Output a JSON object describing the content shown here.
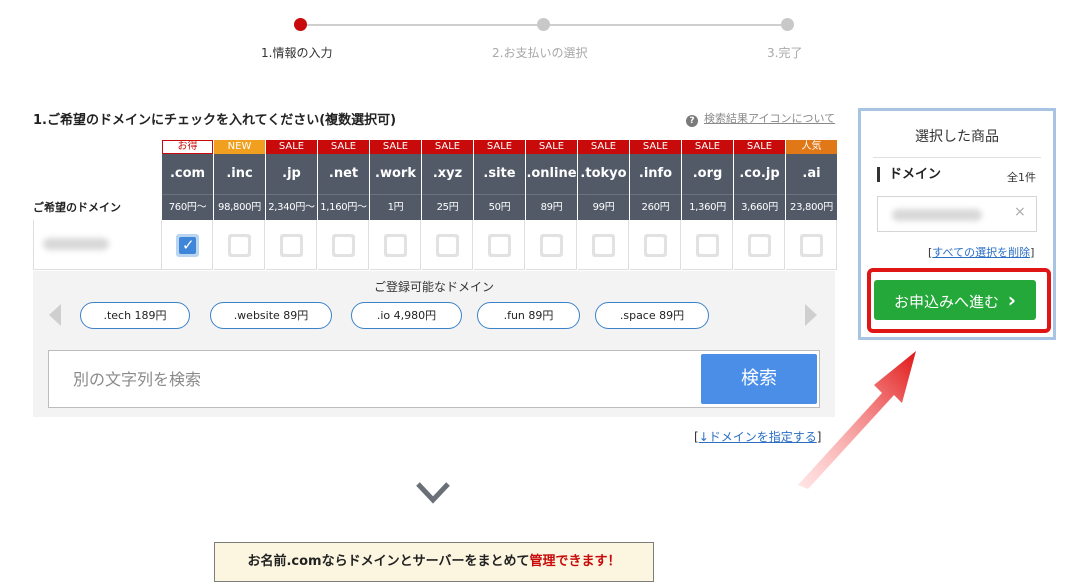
{
  "steps": [
    {
      "label": "1.情報の入力",
      "active": true
    },
    {
      "label": "2.お支払いの選択",
      "active": false
    },
    {
      "label": "3.完了",
      "active": false
    }
  ],
  "section_title": "1.ご希望のドメインにチェックを入れてください(複数選択可)",
  "help_link": "検索結果アイコンについて",
  "domain_row_label": "ご希望のドメイン",
  "tlds": [
    {
      "tag": "お得",
      "tag_type": "deal",
      "tld": ".com",
      "price": "760円〜",
      "checked": true
    },
    {
      "tag": "NEW",
      "tag_type": "new",
      "tld": ".inc",
      "price": "98,800円",
      "checked": false
    },
    {
      "tag": "SALE",
      "tag_type": "sale",
      "tld": ".jp",
      "price": "2,340円〜",
      "checked": false
    },
    {
      "tag": "SALE",
      "tag_type": "sale",
      "tld": ".net",
      "price": "1,160円〜",
      "checked": false
    },
    {
      "tag": "SALE",
      "tag_type": "sale",
      "tld": ".work",
      "price": "1円",
      "checked": false
    },
    {
      "tag": "SALE",
      "tag_type": "sale",
      "tld": ".xyz",
      "price": "25円",
      "checked": false
    },
    {
      "tag": "SALE",
      "tag_type": "sale",
      "tld": ".site",
      "price": "50円",
      "checked": false
    },
    {
      "tag": "SALE",
      "tag_type": "sale",
      "tld": ".online",
      "price": "89円",
      "checked": false
    },
    {
      "tag": "SALE",
      "tag_type": "sale",
      "tld": ".tokyo",
      "price": "99円",
      "checked": false
    },
    {
      "tag": "SALE",
      "tag_type": "sale",
      "tld": ".info",
      "price": "260円",
      "checked": false
    },
    {
      "tag": "SALE",
      "tag_type": "sale",
      "tld": ".org",
      "price": "1,360円",
      "checked": false
    },
    {
      "tag": "SALE",
      "tag_type": "sale",
      "tld": ".co.jp",
      "price": "3,660円",
      "checked": false
    },
    {
      "tag": "人気",
      "tag_type": "pop",
      "tld": ".ai",
      "price": "23,800円",
      "checked": false
    }
  ],
  "suggest": {
    "title": "ご登録可能なドメイン",
    "pills": [
      ".tech 189円",
      ".website 89円",
      ".io 4,980円",
      ".fun 89円",
      ".space 89円"
    ]
  },
  "search": {
    "placeholder": "別の文字列を検索",
    "button": "検索"
  },
  "specify_link": {
    "open": "[",
    "text": "↓ドメインを指定する",
    "close": "]"
  },
  "banner": {
    "text": "お名前.comならドメインとサーバーをまとめて",
    "highlight": "管理できます！"
  },
  "side": {
    "title": "選択した商品",
    "domain_label": "ドメイン",
    "count": "全1件",
    "remove": "×",
    "clear": {
      "open": "[",
      "text": "すべての選択を削除",
      "close": "]"
    },
    "apply_button": "お申込みへ進む",
    "apply_chevron": "›"
  },
  "colors": {
    "accent_red": "#c80a0a",
    "header_dark": "#525a68",
    "search_blue": "#4a8ee8",
    "apply_green": "#25a83a",
    "highlight_frame": "#e01515"
  }
}
